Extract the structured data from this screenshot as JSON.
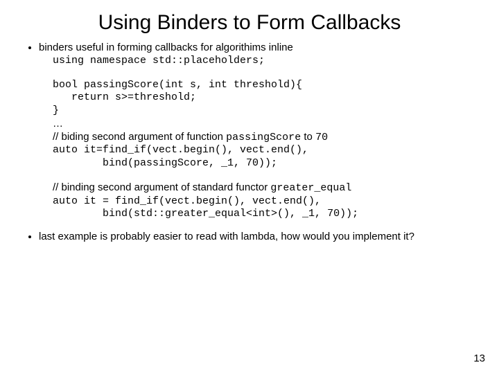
{
  "title": "Using Binders to Form Callbacks",
  "bullet1_intro": "binders useful in forming callbacks for algorithims inline",
  "code_using": "using namespace std::placeholders;",
  "code_func1": "bool passingScore(int s, int threshold){",
  "code_func2": "   return s>=threshold;",
  "code_func3": "}",
  "ellipsis": "…",
  "comment1_pre": "// biding second argument of function ",
  "comment1_code1": "passingScore",
  "comment1_mid": " to ",
  "comment1_code2": "70",
  "code_find1": "auto it=find_if(vect.begin(), vect.end(),",
  "code_find2": "        bind(passingScore, _1, 70));",
  "comment2_pre": "// binding second argument of standard functor ",
  "comment2_code": "greater_equal",
  "code_find3": "auto it = find_if(vect.begin(), vect.end(),",
  "code_find4": "        bind(std::greater_equal<int>(), _1, 70));",
  "bullet2": "last example is probably easier to read with lambda, how would you implement it?",
  "pagenum": "13"
}
